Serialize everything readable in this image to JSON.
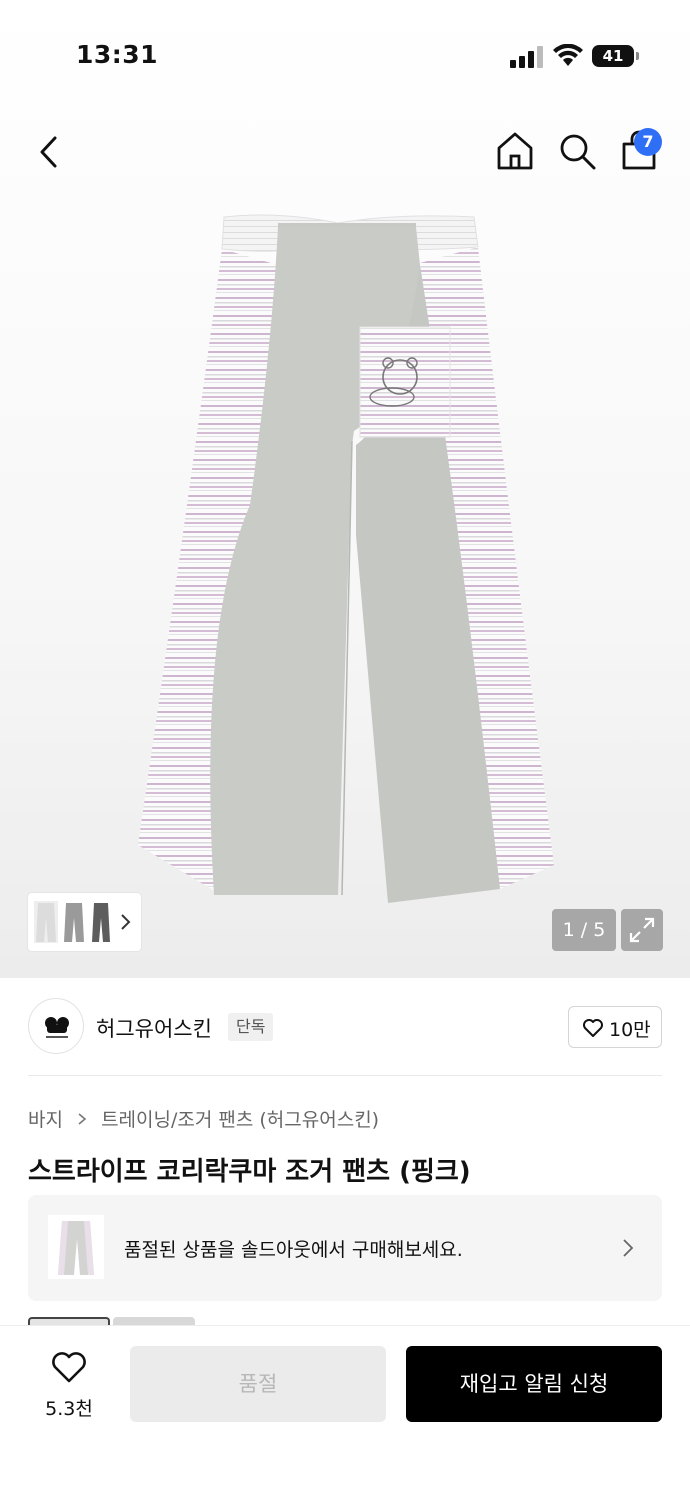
{
  "status_bar": {
    "time": "13:31",
    "battery": "41"
  },
  "nav": {
    "cart_count": "7"
  },
  "gallery": {
    "counter": "1 / 5"
  },
  "brand": {
    "name": "허그유어스킨",
    "tag": "단독",
    "likes": "10만"
  },
  "product": {
    "breadcrumb": [
      "바지",
      "트레이닝/조거 팬츠 (허그유어스킨)"
    ],
    "title": "스트라이프 코리락쿠마 조거 팬츠 (핑크)"
  },
  "soldout_banner": {
    "text": "품절된 상품을 솔드아웃에서 구매해보세요."
  },
  "bottom_bar": {
    "wish_count": "5.3천",
    "soldout_label": "품절",
    "restock_label": "재입고 알림 신청"
  },
  "colors": {
    "accent_badge": "#2f6ff5",
    "stripe_pink": "#cfb6d0",
    "panel_grey": "#c9cbc7"
  }
}
